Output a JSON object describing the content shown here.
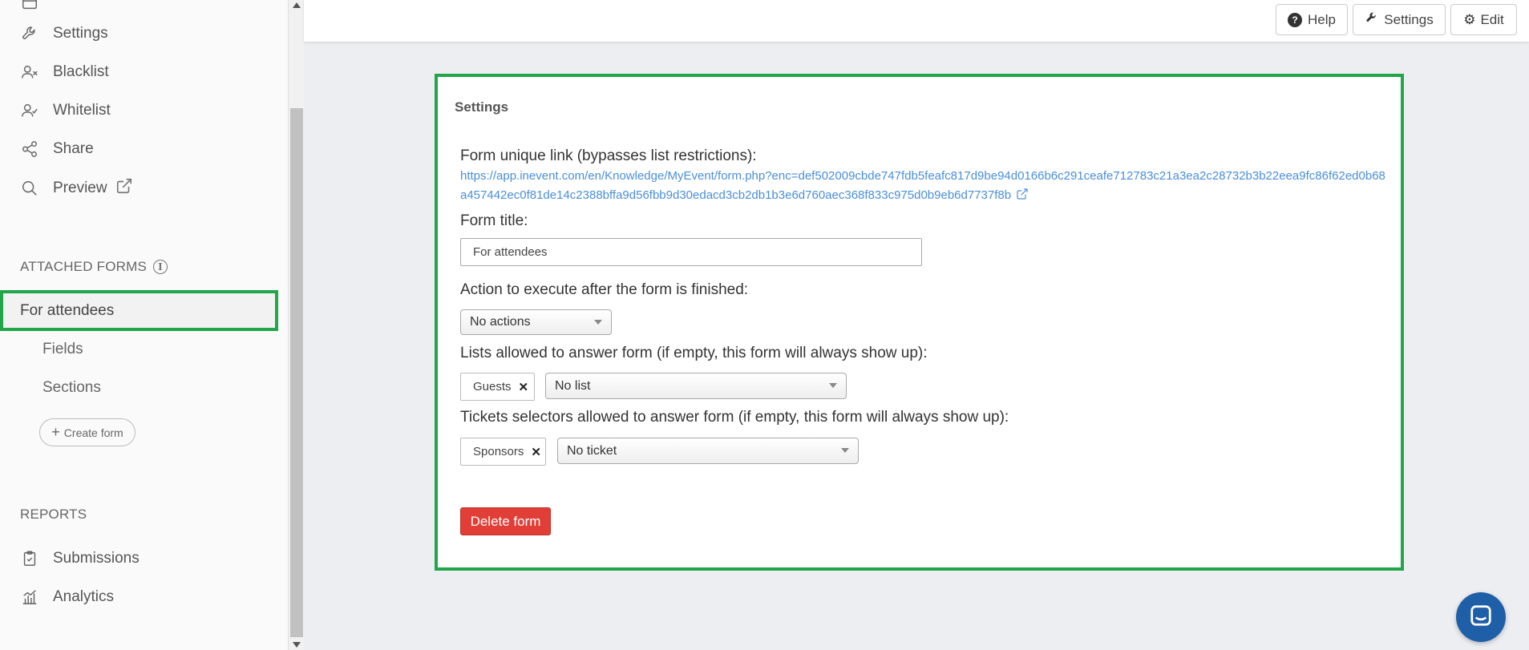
{
  "sidebar": {
    "items": [
      {
        "label": "Settings",
        "icon": "wrench-icon"
      },
      {
        "label": "Blacklist",
        "icon": "user-x-icon"
      },
      {
        "label": "Whitelist",
        "icon": "user-check-icon"
      },
      {
        "label": "Share",
        "icon": "share-icon"
      },
      {
        "label": "Preview",
        "icon": "search-icon"
      }
    ],
    "attached_forms_header": "ATTACHED FORMS",
    "active_form": "For attendees",
    "sub_items": [
      "Fields",
      "Sections"
    ],
    "create_form_label": "Create form",
    "reports_header": "REPORTS",
    "reports": [
      {
        "label": "Submissions",
        "icon": "clipboard-check-icon"
      },
      {
        "label": "Analytics",
        "icon": "bar-chart-icon"
      }
    ]
  },
  "topbar": {
    "help_label": "Help",
    "settings_label": "Settings",
    "edit_label": "Edit"
  },
  "card": {
    "title": "Settings",
    "link_label": "Form unique link (bypasses list restrictions):",
    "link_url": "https://app.inevent.com/en/Knowledge/MyEvent/form.php?enc=def502009cbde747fdb5feafc817d9be94d0166b6c291ceafe712783c21a3ea2c28732b3b22eea9fc86f62ed0b68a457442ec0f81de14c2388bffa9d56fbb9d30edacd3cb2db1b3e6d760aec368f833c975d0b9eb6d7737f8b",
    "form_title_label": "Form title:",
    "form_title_value": "For attendees",
    "action_label": "Action to execute after the form is finished:",
    "action_value": "No actions",
    "lists_label": "Lists allowed to answer form (if empty, this form will always show up):",
    "lists_tag": "Guests",
    "lists_select": "No list",
    "tickets_label": "Tickets selectors allowed to answer form (if empty, this form will always show up):",
    "tickets_tag": "Sponsors",
    "tickets_select": "No ticket",
    "delete_label": "Delete form"
  },
  "colors": {
    "highlight": "#22a64a",
    "link": "#4a8fd9",
    "danger": "#e03e36",
    "chat": "#1f5fa8"
  }
}
